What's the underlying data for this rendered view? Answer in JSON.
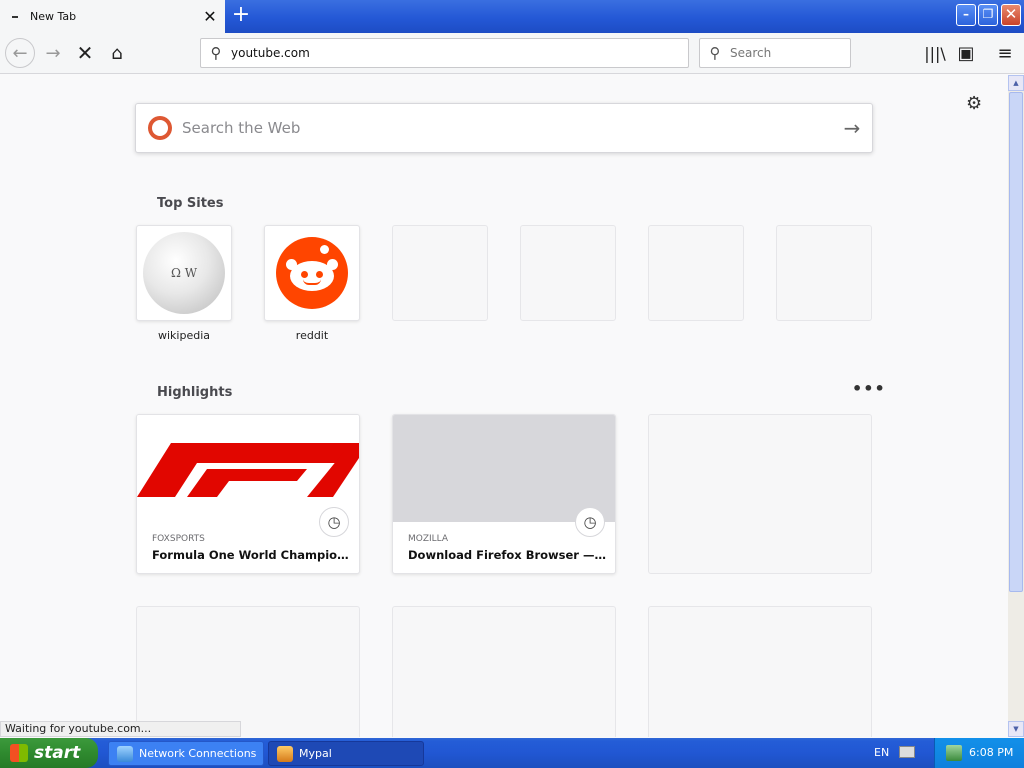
{
  "tab": {
    "title": "New Tab",
    "close": "✕"
  },
  "toolbar": {
    "newtab": "+",
    "back": "←",
    "forward": "→",
    "stop": "✕",
    "home": "⌂",
    "url": "youtube.com",
    "search_placeholder": "Search",
    "library_icon": "|||\\",
    "sidebar_icon": "▣",
    "menu_icon": "≡"
  },
  "window": {
    "min": "–",
    "max": "❐",
    "close": "✕"
  },
  "newtab_page": {
    "settings_icon": "⚙",
    "websearch_placeholder": "Search the Web",
    "websearch_arrow": "→",
    "top_sites_title": "Top Sites",
    "top_sites": [
      {
        "label": "wikipedia"
      },
      {
        "label": "reddit"
      }
    ],
    "highlights_title": "Highlights",
    "highlights_more": "•••",
    "highlights": [
      {
        "source": "FOXSPORTS",
        "title": "Formula One World Championship"
      },
      {
        "source": "MOZILLA",
        "title": "Download Firefox Browser — Fast, Private & Free"
      }
    ],
    "wiki_glyphs": "Ω W"
  },
  "statusbar": {
    "text": "Waiting for youtube.com..."
  },
  "taskbar": {
    "start": "start",
    "tasks": [
      "Network Connections",
      "Mypal"
    ],
    "language": "EN",
    "clock": "6:08 PM"
  },
  "colors": {
    "reddit": "#ff4500",
    "f1_red": "#e10600",
    "xp_blue": "#245dd7",
    "start_green": "#3c9a3c"
  }
}
